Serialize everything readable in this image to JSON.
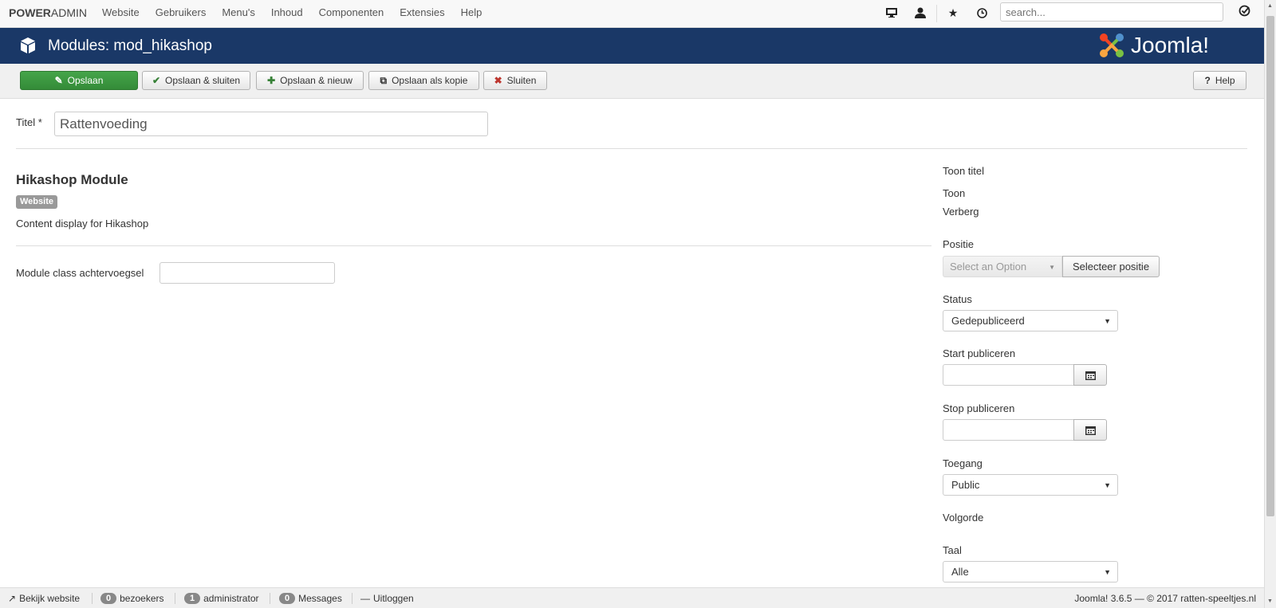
{
  "brand": {
    "bold": "POWER",
    "normal": "ADMIN"
  },
  "menu": [
    "Website",
    "Gebruikers",
    "Menu's",
    "Inhoud",
    "Componenten",
    "Extensies",
    "Help"
  ],
  "search": {
    "placeholder": "search..."
  },
  "header": {
    "title": "Modules: mod_hikashop",
    "logo_text": "Joomla!"
  },
  "toolbar": {
    "save": "Opslaan",
    "save_close": "Opslaan & sluiten",
    "save_new": "Opslaan & nieuw",
    "save_copy": "Opslaan als kopie",
    "close": "Sluiten",
    "help": "Help"
  },
  "form": {
    "title_label": "Titel *",
    "title_value": "Rattenvoeding",
    "module_heading": "Hikashop Module",
    "badge": "Website",
    "description": "Content display for Hikashop",
    "class_suffix_label": "Module class achtervoegsel"
  },
  "sidebar": {
    "show_title_label": "Toon titel",
    "show_option": "Toon",
    "hide_option": "Verberg",
    "position_label": "Positie",
    "position_placeholder": "Select an Option",
    "position_button": "Selecteer positie",
    "status_label": "Status",
    "status_value": "Gedepubliceerd",
    "start_label": "Start publiceren",
    "stop_label": "Stop publiceren",
    "access_label": "Toegang",
    "access_value": "Public",
    "order_label": "Volgorde",
    "language_label": "Taal",
    "language_value": "Alle"
  },
  "footer": {
    "view_site": "Bekijk website",
    "visitors_count": "0",
    "visitors_label": "bezoekers",
    "admin_count": "1",
    "admin_label": "administrator",
    "messages_count": "0",
    "messages_label": "Messages",
    "logout": "Uitloggen",
    "copyright": "Joomla! 3.6.5  —  © 2017 ratten-speeltjes.nl"
  },
  "colors": {
    "header_bg": "#1a3867",
    "success": "#3c9a40",
    "badge": "#999999"
  }
}
